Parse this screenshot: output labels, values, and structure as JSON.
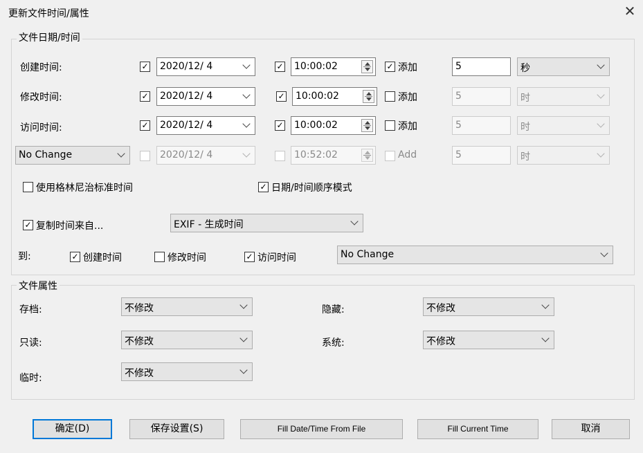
{
  "window": {
    "title": "更新文件时间/属性"
  },
  "date_group": {
    "title": "文件日期/时间",
    "rows": [
      {
        "label": "创建时间:",
        "date": "2020/12/ 4",
        "time": "10:00:02",
        "add_label": "添加",
        "add_checked": true,
        "amount": "5",
        "unit": "秒"
      },
      {
        "label": "修改时间:",
        "date": "2020/12/ 4",
        "time": "10:00:02",
        "add_label": "添加",
        "add_checked": false,
        "amount": "5",
        "unit": "时"
      },
      {
        "label": "访问时间:",
        "date": "2020/12/ 4",
        "time": "10:00:02",
        "add_label": "添加",
        "add_checked": false,
        "amount": "5",
        "unit": "时"
      },
      {
        "mode": "No Change",
        "date": "2020/12/ 4",
        "time": "10:52:02",
        "add_label": "Add",
        "amount": "5",
        "unit": "时"
      }
    ],
    "use_gmt_label": "使用格林尼治标准时间",
    "sequential_label": "日期/时间顺序模式",
    "copy_from_label": "复制时间来自...",
    "copy_source": "EXIF - 生成时间",
    "to_label": "到:",
    "to_create": "创建时间",
    "to_modify": "修改时间",
    "to_access": "访问时间",
    "to_mode": "No Change"
  },
  "attr_group": {
    "title": "文件属性",
    "archive_label": "存档:",
    "archive_value": "不修改",
    "hidden_label": "隐藏:",
    "hidden_value": "不修改",
    "readonly_label": "只读:",
    "readonly_value": "不修改",
    "system_label": "系统:",
    "system_value": "不修改",
    "temp_label": "临时:",
    "temp_value": "不修改"
  },
  "buttons": {
    "ok": "确定(D)",
    "save": "保存设置(S)",
    "fill_file": "Fill Date/Time From File",
    "fill_current": "Fill Current Time",
    "cancel": "取消"
  },
  "icons": {
    "close": "close-icon",
    "check": "check-mark-icon"
  }
}
